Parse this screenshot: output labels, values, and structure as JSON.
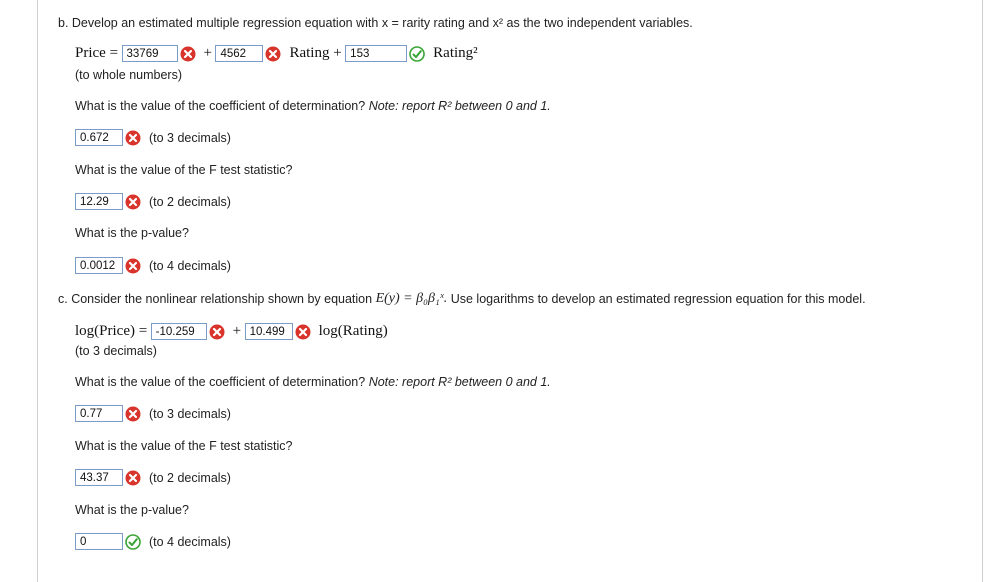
{
  "part_b": {
    "question": "b. Develop an estimated multiple regression equation with",
    "question_vars": "x = rarity rating and x² as the two independent variables.",
    "price_label": "Price =",
    "input_intercept": "33769",
    "plus1": "+",
    "input_rating": "4562",
    "rating_label": "Rating +",
    "input_rating2": "153",
    "rating2_label": "Rating²",
    "whole_note": "(to whole numbers)",
    "r2_question": "What is the value of the coefficient of determination?",
    "r2_note": "Note: report R² between 0 and 1.",
    "r2_value": "0.672",
    "r2_hint": "(to 3 decimals)",
    "f_question": "What is the value of the F test statistic?",
    "f_value": "12.29",
    "f_hint": "(to 2 decimals)",
    "p_question": "What is the p-value?",
    "p_value": "0.0012",
    "p_hint": "(to 4 decimals)"
  },
  "part_c": {
    "question_start": "c. Consider the nonlinear relationship shown by equation",
    "equation": "E(y) = β₀β₁ˣ.",
    "question_end": "Use logarithms to develop an estimated regression equation for this model.",
    "log_price_label": "log(Price) =",
    "input_intercept": "-10.259",
    "plus": "+",
    "input_slope": "10.499",
    "log_rating_label": "log(Rating)",
    "decimals_note": "(to 3 decimals)",
    "r2_question": "What is the value of the coefficient of determination?",
    "r2_note": "Note: report R² between 0 and 1.",
    "r2_value": "0.77",
    "r2_hint": "(to 3 decimals)",
    "f_question": "What is the value of the F test statistic?",
    "f_value": "43.37",
    "f_hint": "(to 2 decimals)",
    "p_question": "What is the p-value?",
    "p_value": "0",
    "p_hint": "(to 4 decimals)"
  },
  "colors": {
    "incorrect": "#d9342b",
    "correct": "#3aa535",
    "input_border": "#7a9cc6"
  }
}
